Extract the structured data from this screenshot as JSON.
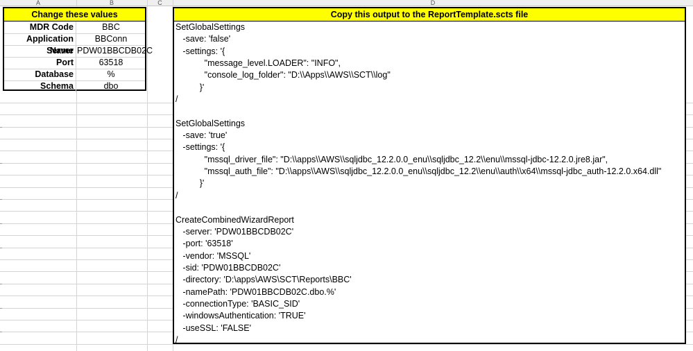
{
  "columns": [
    "A",
    "B",
    "C",
    "D"
  ],
  "settings": {
    "header": "Change these values",
    "rows": [
      {
        "key": "MDR Code",
        "value": "BBC"
      },
      {
        "key": "Application Name",
        "value": "BBConn"
      },
      {
        "key": "Server",
        "value": "PDW01BBCDB02C"
      },
      {
        "key": "Port",
        "value": "63518"
      },
      {
        "key": "Database",
        "value": "%"
      },
      {
        "key": "Schema",
        "value": "dbo"
      }
    ]
  },
  "output": {
    "header": "Copy this output to the ReportTemplate.scts file",
    "lines": [
      "SetGlobalSettings",
      "   -save: 'false'",
      "   -settings: '{",
      "            \"message_level.LOADER\": \"INFO\",",
      "            \"console_log_folder\": \"D:\\\\Apps\\\\AWS\\\\SCT\\\\log\"",
      "          }'",
      "/",
      "",
      "SetGlobalSettings",
      "   -save: 'true'",
      "   -settings: '{",
      "            \"mssql_driver_file\": \"D:\\\\apps\\\\AWS\\\\sqljdbc_12.2.0.0_enu\\\\sqljdbc_12.2\\\\enu\\\\mssql-jdbc-12.2.0.jre8.jar\",",
      "            \"mssql_auth_file\": \"D:\\\\apps\\\\AWS\\\\sqljdbc_12.2.0.0_enu\\\\sqljdbc_12.2\\\\enu\\\\auth\\\\x64\\\\mssql-jdbc_auth-12.2.0.x64.dll\"",
      "          }'",
      "/",
      "",
      "CreateCombinedWizardReport",
      "   -server: 'PDW01BBCDB02C'",
      "   -port: '63518'",
      "   -vendor: 'MSSQL'",
      "   -sid: 'PDW01BBCDB02C'",
      "   -directory: 'D:\\apps\\AWS\\SCT\\Reports\\BBC'",
      "   -namePath: 'PDW01BBCDB02C.dbo.%'",
      "   -connectionType: 'BASIC_SID'",
      "   -windowsAuthentication: 'TRUE'",
      "   -useSSL: 'FALSE'",
      "/"
    ]
  }
}
